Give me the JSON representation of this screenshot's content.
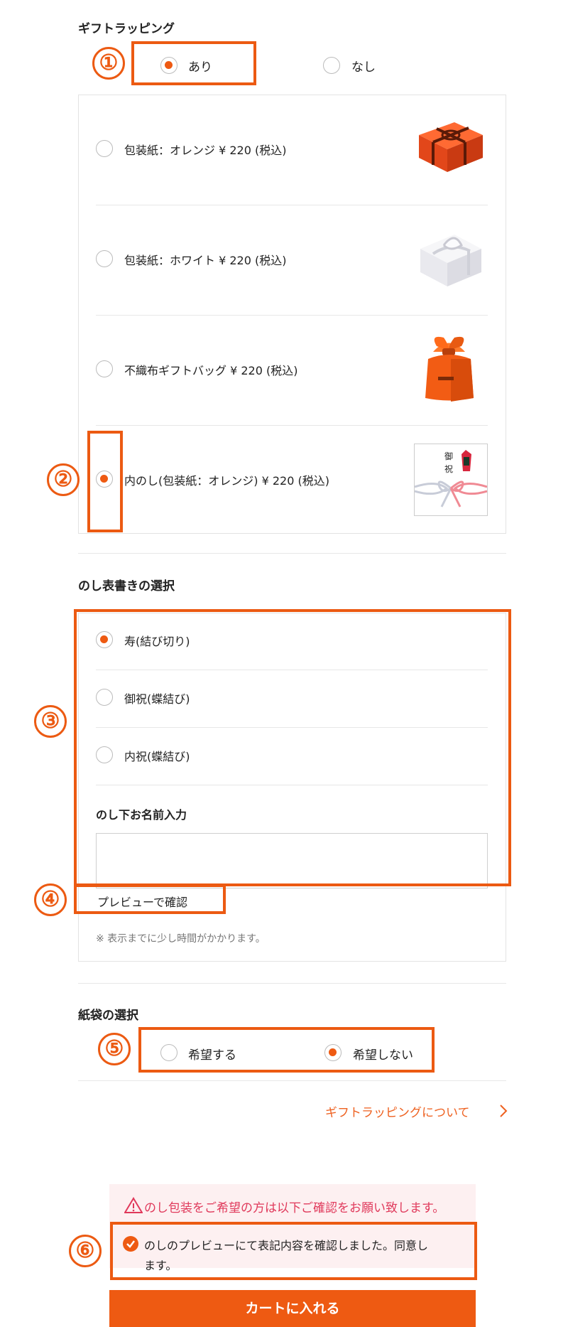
{
  "gift_wrapping": {
    "title": "ギフトラッピング",
    "options": [
      "あり",
      "なし"
    ],
    "selected": "あり",
    "styles": [
      {
        "label": "包装紙：オレンジ ¥ 220 (税込)",
        "image": "orange-gift-box-image",
        "selected": false
      },
      {
        "label": "包装紙：ホワイト ¥ 220 (税込)",
        "image": "white-gift-box-image",
        "selected": false
      },
      {
        "label": "不織布ギフトバッグ ¥ 220 (税込)",
        "image": "orange-gift-bag-image",
        "selected": false
      },
      {
        "label": "内のし(包装紙：オレンジ) ¥ 220 (税込)",
        "image": "noshi-paper-image",
        "selected": true
      }
    ]
  },
  "noshi": {
    "title": "のし表書きの選択",
    "options": [
      "寿(結び切り)",
      "御祝(蝶結び)",
      "内祝(蝶結び)"
    ],
    "selected": "寿(結び切り)",
    "name_label": "のし下お名前入力",
    "name_value": "",
    "preview_link": "プレビューで確認",
    "note": "※ 表示までに少し時間がかかります。",
    "image_text": [
      "御",
      "祝"
    ]
  },
  "paper_bag": {
    "title": "紙袋の選択",
    "options": [
      "希望する",
      "希望しない"
    ],
    "selected": "希望しない"
  },
  "about_link": "ギフトラッピングについて",
  "warning": {
    "text": "のし包装をご希望の方は以下ご確認をお願い致します。",
    "icon": "warning-triangle-icon"
  },
  "agreement": {
    "text_line1": "のしのプレビューにて表記内容を確認しました。同意し",
    "text_line2": "ます。",
    "checked": true
  },
  "cart_button": "カートに入れる",
  "annotations": [
    "①",
    "②",
    "③",
    "④",
    "⑤",
    "⑥"
  ],
  "colors": {
    "accent": "#ee5a12",
    "annotation": "#ec5a12",
    "warning": "#e0395b",
    "warning_bg": "#fdf0f1"
  }
}
